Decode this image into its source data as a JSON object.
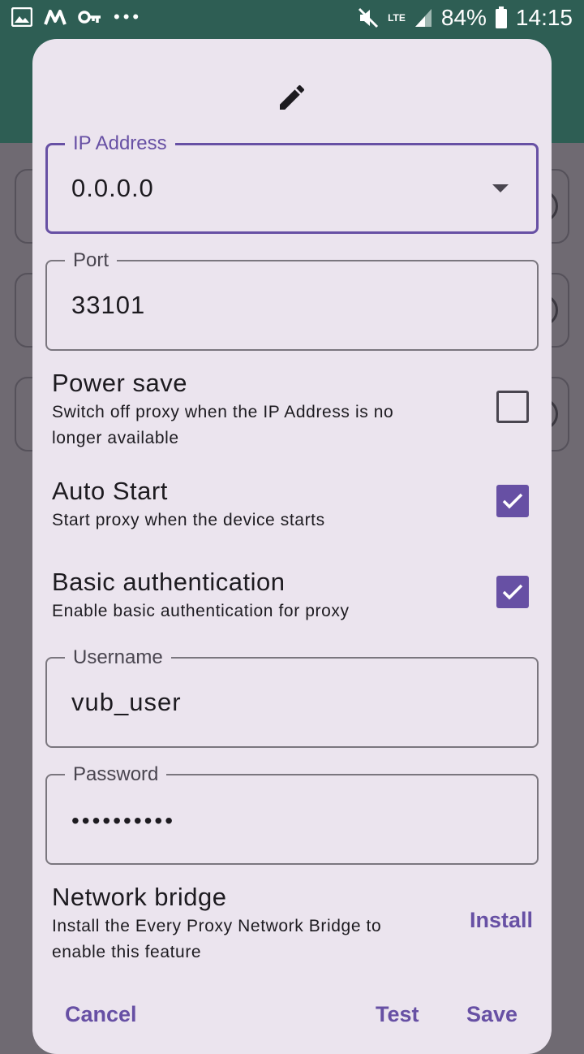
{
  "status_bar": {
    "lte": "LTE",
    "battery": "84%",
    "time": "14:15",
    "dots": "•••"
  },
  "dialog": {
    "header_icon": "pencil-icon",
    "ip_field": {
      "label": "IP Address",
      "value": "0.0.0.0"
    },
    "port_field": {
      "label": "Port",
      "value": "33101"
    },
    "power_save": {
      "title": "Power save",
      "description": "Switch off proxy when the IP Address is no longer available",
      "checked": false
    },
    "auto_start": {
      "title": "Auto Start",
      "description": "Start proxy when the device starts",
      "checked": true
    },
    "basic_auth": {
      "title": "Basic authentication",
      "description": "Enable basic authentication for proxy",
      "checked": true
    },
    "username_field": {
      "label": "Username",
      "value": "vub_user"
    },
    "password_field": {
      "label": "Password",
      "value": "••••••••••"
    },
    "network_bridge": {
      "title": "Network bridge",
      "description": "Install the Every Proxy Network Bridge to enable this feature",
      "install_label": "Install"
    },
    "actions": {
      "cancel": "Cancel",
      "test": "Test",
      "save": "Save"
    }
  },
  "colors": {
    "accent": "#6750a4",
    "app_bar": "#2e5e54",
    "dialog_bg": "#ebe4ee",
    "scrim": "#6f6a72"
  }
}
